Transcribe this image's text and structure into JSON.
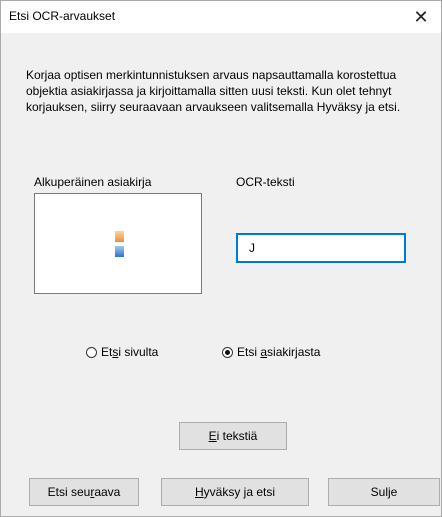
{
  "dialog": {
    "title": "Etsi OCR-arvaukset",
    "close_glyph": "✕",
    "instructions": "Korjaa optisen merkintunnistuksen arvaus napsauttamalla korostettua objektia asiakirjassa ja kirjoittamalla sitten uusi teksti. Kun olet tehnyt korjauksen, siirry seuraavaan arvaukseen valitsemalla Hyväksy ja etsi."
  },
  "labels": {
    "original_document": "Alkuperäinen asiakirja",
    "ocr_text": "OCR-teksti"
  },
  "ocr_input": {
    "value": "J"
  },
  "scope": {
    "options": [
      {
        "pre": "Et",
        "key": "s",
        "post": "i sivulta",
        "checked": false
      },
      {
        "pre": "Etsi ",
        "key": "a",
        "post": "siakirjasta",
        "checked": true
      }
    ]
  },
  "buttons": {
    "no_text": {
      "pre": "",
      "key": "E",
      "post": "i tekstiä"
    },
    "find_next": {
      "pre": "Etsi seu",
      "key": "r",
      "post": "aava"
    },
    "accept_find": {
      "pre": "",
      "key": "H",
      "post": "yväksy ja etsi"
    },
    "close": {
      "pre": "Sul",
      "key": "j",
      "post": "e"
    }
  },
  "icons": {
    "close": "close-icon",
    "radio": "radio-icon"
  },
  "colors": {
    "focus_border": "#0078d7",
    "button_face": "#e1e1e1",
    "dialog_bg": "#f0f0f0"
  }
}
